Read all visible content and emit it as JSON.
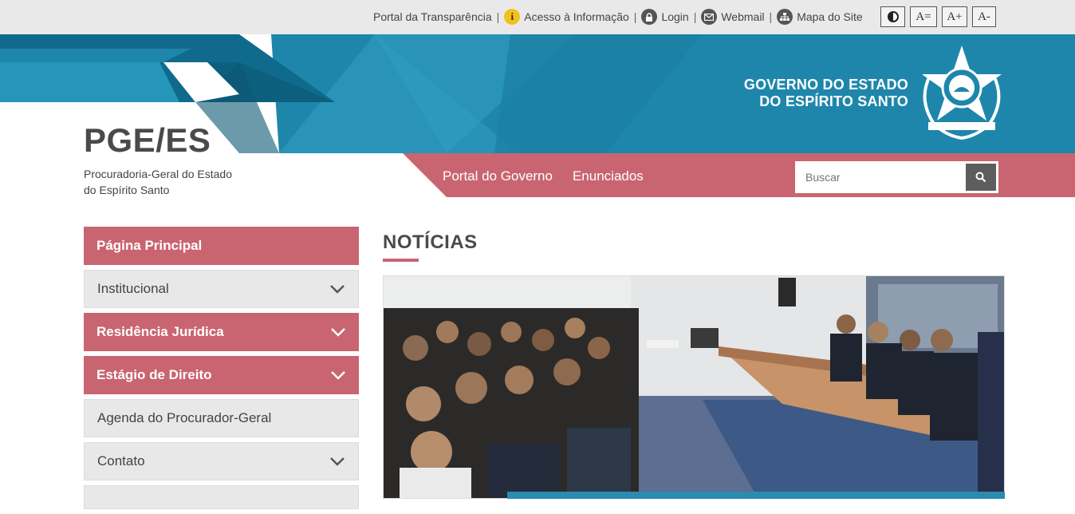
{
  "topbar": {
    "links": [
      {
        "label": "Portal da Transparência",
        "icon": "none"
      },
      {
        "label": "Acesso à Informação",
        "icon": "info-icon"
      },
      {
        "label": "Login",
        "icon": "lock-icon"
      },
      {
        "label": "Webmail",
        "icon": "mail-icon"
      },
      {
        "label": "Mapa do Site",
        "icon": "sitemap-icon"
      }
    ],
    "separator": "|",
    "a11y": {
      "font_reset": "A=",
      "font_increase": "A+",
      "font_decrease": "A-"
    }
  },
  "header": {
    "gov_line1": "GOVERNO DO ESTADO",
    "gov_line2": "DO ESPÍRITO SANTO",
    "brand_title": "PGE/ES",
    "brand_sub_line1": "Procuradoria-Geral do Estado",
    "brand_sub_line2": "do Espírito Santo"
  },
  "nav": {
    "items": [
      "Portal do Governo",
      "Enunciados"
    ],
    "search_placeholder": "Buscar"
  },
  "sidebar": {
    "items": [
      {
        "label": "Página Principal",
        "style": "pink",
        "expandable": false
      },
      {
        "label": "Institucional",
        "style": "grey",
        "expandable": true
      },
      {
        "label": "Residência Jurídica",
        "style": "pink",
        "expandable": true
      },
      {
        "label": "Estágio de Direito",
        "style": "pink",
        "expandable": true
      },
      {
        "label": "Agenda do Procurador-Geral",
        "style": "grey",
        "expandable": false
      },
      {
        "label": "Contato",
        "style": "grey",
        "expandable": true
      }
    ]
  },
  "main": {
    "section_title": "NOTÍCIAS"
  },
  "colors": {
    "accent_pink": "#c96570",
    "banner_blue": "#1e86ab",
    "banner_dark": "#0f6a8c",
    "topbar_bg": "#e9e9e9"
  }
}
